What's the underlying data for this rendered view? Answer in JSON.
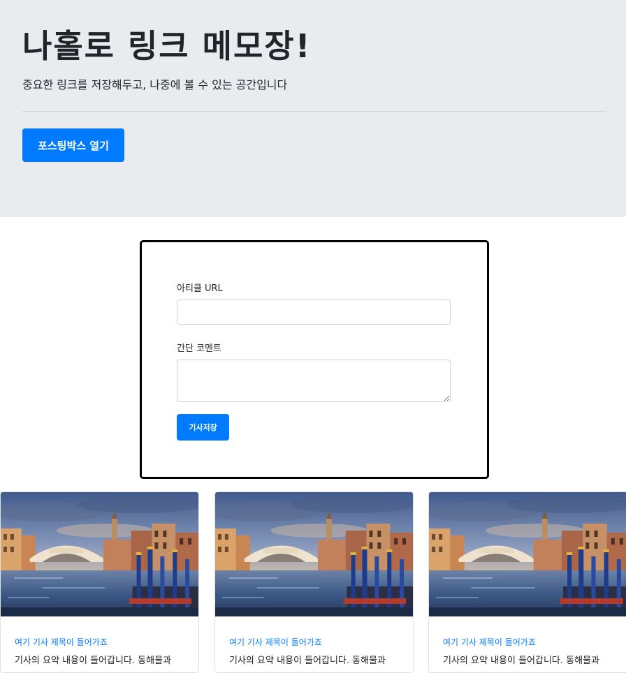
{
  "header": {
    "title": "나홀로 링크 메모장!",
    "subtitle": "중요한 링크를 저장해두고, 나중에 볼 수 있는 공간입니다",
    "open_button_label": "포스팅박스 열기"
  },
  "posting_box": {
    "url_label": "아티클 URL",
    "url_value": "",
    "comment_label": "간단 코멘트",
    "comment_value": "",
    "save_button_label": "기사저장"
  },
  "cards": [
    {
      "title": "여기 기사 제목이 들어가죠",
      "summary": "기사의 요약 내용이 들어갑니다. 동해물과"
    },
    {
      "title": "여기 기사 제목이 들어가죠",
      "summary": "기사의 요약 내용이 들어갑니다. 동해물과"
    },
    {
      "title": "여기 기사 제목이 들어가죠",
      "summary": "기사의 요약 내용이 들어갑니다. 동해물과"
    }
  ],
  "colors": {
    "primary": "#007bff",
    "jumbotron_bg": "#e9ecef",
    "text": "#212529"
  }
}
